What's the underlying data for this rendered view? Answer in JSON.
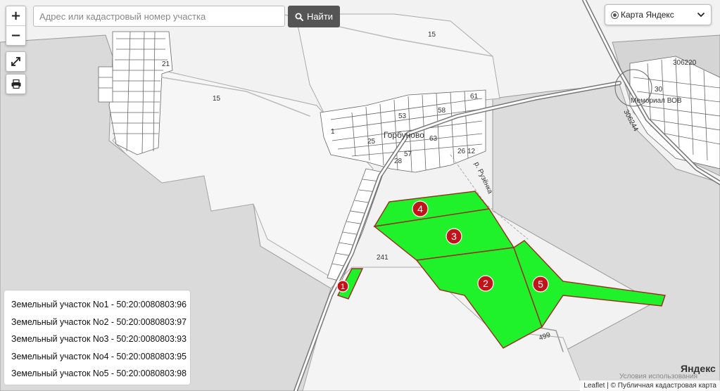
{
  "search": {
    "placeholder": "Адрес или кадастровый номер участка",
    "button_label": "Найти"
  },
  "zoom": {
    "in_label": "+",
    "out_label": "−"
  },
  "tools": {
    "fullscreen_icon": "expand-icon",
    "print_icon": "printer-icon"
  },
  "layer_select": {
    "selected": "Карта Яндекс"
  },
  "map": {
    "place_name": "Горбуново",
    "road_labels": [
      "15",
      "15",
      "241",
      "306220",
      "306244",
      "499",
      "р. Рузёнка"
    ],
    "building_numbers": [
      "21",
      "53",
      "58",
      "61",
      "1",
      "25",
      "57",
      "63",
      "28",
      "26",
      "12",
      "30"
    ],
    "memorial_label": "Мемориал ВОВ",
    "plot_markers": [
      "1",
      "2",
      "3",
      "4",
      "5"
    ],
    "colors": {
      "plot_fill": "#1ff22b",
      "plot_border": "#9b2a1f",
      "marker_fill": "#c0141b",
      "road": "#777777",
      "gray_area": "#d9d9d9"
    }
  },
  "legend": {
    "items": [
      "Земельный участок No1 - 50:20:0080803:96",
      "Земельный участок No2 - 50:20:0080803:97",
      "Земельный участок No3 - 50:20:0080803:93",
      "Земельный участок No4 - 50:20:0080803:95",
      "Земельный участок No5 - 50:20:0080803:98"
    ]
  },
  "attribution": {
    "leaflet": "Leaflet",
    "separator": "| ©",
    "source": "Публичная кадастровая карта",
    "yandex": "Яндекс",
    "terms": "Условия использования"
  }
}
